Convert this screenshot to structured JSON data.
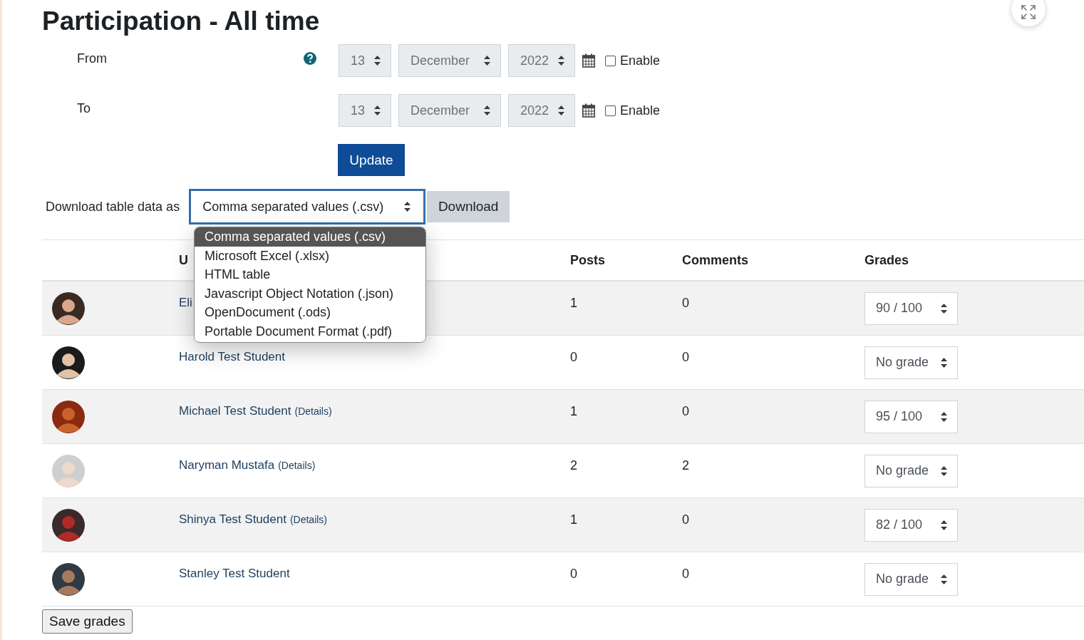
{
  "heading": "Participation - All time",
  "date_rows": [
    {
      "label": "From",
      "has_help": true,
      "day": "13",
      "month": "December",
      "year": "2022",
      "enable_label": "Enable",
      "checked": false
    },
    {
      "label": "To",
      "has_help": false,
      "day": "13",
      "month": "December",
      "year": "2022",
      "enable_label": "Enable",
      "checked": false
    }
  ],
  "update_button": "Update",
  "download": {
    "label": "Download table data as",
    "value": "Comma separated values (.csv)",
    "button": "Download",
    "options": [
      {
        "label": "Comma separated values (.csv)",
        "selected": true
      },
      {
        "label": "Microsoft Excel (.xlsx)",
        "selected": false
      },
      {
        "label": "HTML table",
        "selected": false
      },
      {
        "label": "Javascript Object Notation (.json)",
        "selected": false
      },
      {
        "label": "OpenDocument (.ods)",
        "selected": false
      },
      {
        "label": "Portable Document Format (.pdf)",
        "selected": false
      }
    ]
  },
  "table": {
    "columns": [
      "U",
      "Posts",
      "Comments",
      "Grades"
    ],
    "rows": [
      {
        "name": "Eli",
        "posts": "1",
        "comments": "0",
        "grade": "90 / 100"
      },
      {
        "name": "Harold Test Student",
        "posts": "0",
        "comments": "0",
        "grade": "No grade"
      },
      {
        "name": "Michael Test Student",
        "details": "(Details)",
        "posts": "1",
        "comments": "0",
        "grade": "95 / 100"
      },
      {
        "name": "Naryman Mustafa",
        "details": "(Details)",
        "posts": "2",
        "comments": "2",
        "grade": "No grade"
      },
      {
        "name": "Shinya Test Student",
        "details": "(Details)",
        "posts": "1",
        "comments": "0",
        "grade": "82 / 100"
      },
      {
        "name": "Stanley Test Student",
        "posts": "0",
        "comments": "0",
        "grade": "No grade"
      }
    ]
  },
  "save_button": "Save grades"
}
